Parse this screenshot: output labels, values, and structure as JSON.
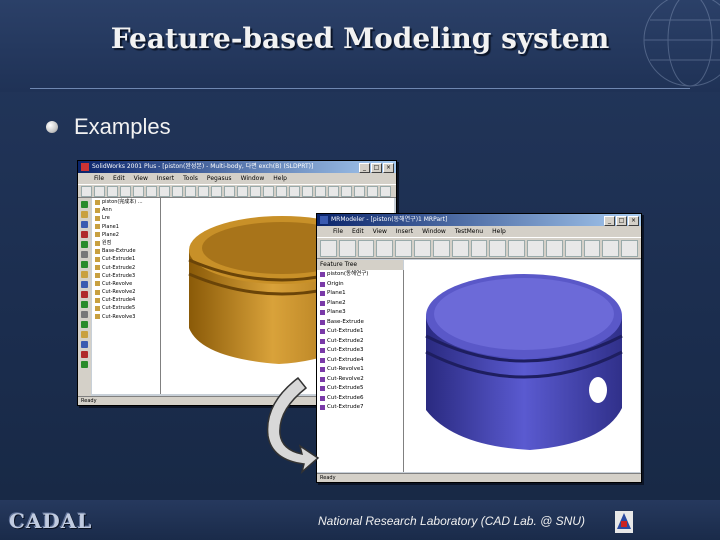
{
  "slide": {
    "title": "Feature-based Modeling system",
    "bullet": "Examples",
    "footer_logo": "CADAL",
    "footer_text": "National Research Laboratory (CAD Lab. @ SNU)"
  },
  "window1": {
    "title": "SolidWorks 2001 Plus - [piston(완성본) - Multi-body, 다면 exch(B) (SLDPRT)]",
    "menu": [
      "File",
      "Edit",
      "View",
      "Insert",
      "Tools",
      "Pegasus",
      "Window",
      "Help"
    ],
    "tree": [
      "piston(完成本) ...",
      "Ann",
      "Lre",
      "Plane1",
      "Plane2",
      "원점",
      "Base-Extrude",
      "Cut-Extrude1",
      "Cut-Extrude2",
      "Cut-Extrude3",
      "Cut-Revolve",
      "Cut-Revolve2",
      "Cut-Extrude4",
      "Cut-Extrude5",
      "Cut-Revolve3"
    ],
    "status": "Ready",
    "part_color": "#c8901c"
  },
  "window2": {
    "title": "MRModeler - [piston(동해연구)1 MRPart]",
    "menu": [
      "File",
      "Edit",
      "View",
      "Insert",
      "Window",
      "TestMenu",
      "Help"
    ],
    "tree_header": "Feature Tree",
    "tree": [
      "piston(동해연구)",
      "Origin",
      "Plane1",
      "Plane2",
      "Plane3",
      "Base-Extrude",
      "Cut-Extrude1",
      "Cut-Extrude2",
      "Cut-Extrude3",
      "Cut-Extrude4",
      "Cut-Revolve1",
      "Cut-Revolve2",
      "Cut-Extrude5",
      "Cut-Extrude6",
      "Cut-Extrude7"
    ],
    "status": "Ready",
    "part_color": "#4040a8"
  },
  "icons": [
    "bullet-icon",
    "globe-deco-icon",
    "curved-arrow-icon",
    "snu-logo-icon"
  ]
}
